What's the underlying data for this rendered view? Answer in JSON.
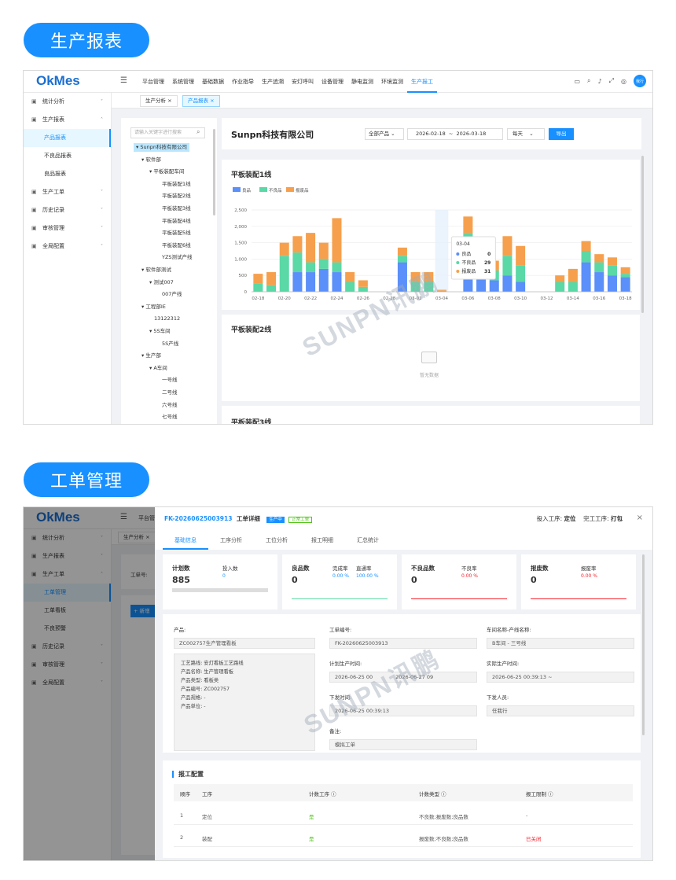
{
  "section1": {
    "title": "生产报表"
  },
  "section2": {
    "title": "工单管理"
  },
  "app": {
    "logo": "OkMes",
    "user": "我行"
  },
  "topnav": [
    "平台管理",
    "系统管理",
    "基础数据",
    "作业指导",
    "生产追溯",
    "安灯呼叫",
    "设备管理",
    "静电监测",
    "环境监测",
    "生产报工"
  ],
  "sidebar1": [
    {
      "label": "统计分析",
      "icon": "chart-icon",
      "chev": "⌄"
    },
    {
      "label": "生产报表",
      "icon": "doc-icon",
      "chev": "⌃"
    },
    {
      "label": "产品报表",
      "sub": true,
      "selected": true
    },
    {
      "label": "不良品报表",
      "sub": true
    },
    {
      "label": "良品报表",
      "sub": true
    },
    {
      "label": "生产工单",
      "icon": "order-icon",
      "chev": "⌄"
    },
    {
      "label": "历史记录",
      "icon": "history-icon",
      "chev": "⌄"
    },
    {
      "label": "审核管理",
      "icon": "audit-icon",
      "chev": "⌄"
    },
    {
      "label": "全局配置",
      "icon": "gear-icon",
      "chev": "⌄"
    }
  ],
  "tabs1": [
    {
      "label": "生产分析 ×"
    },
    {
      "label": "产品报表 ×",
      "active": true
    }
  ],
  "tree": {
    "search_placeholder": "请输入关键字进行搜索",
    "nodes": [
      {
        "t": "Sunpn科技有限公司",
        "d": 0,
        "sel": true
      },
      {
        "t": "软件部",
        "d": 1
      },
      {
        "t": "平板装配车间",
        "d": 2
      },
      {
        "t": "平板装配1线",
        "d": 3
      },
      {
        "t": "平板装配2线",
        "d": 3
      },
      {
        "t": "平板装配3线",
        "d": 3
      },
      {
        "t": "平板装配4线",
        "d": 3
      },
      {
        "t": "平板装配5线",
        "d": 3
      },
      {
        "t": "平板装配6线",
        "d": 3
      },
      {
        "t": "YZS测试产线",
        "d": 3
      },
      {
        "t": "软件部测试",
        "d": 1
      },
      {
        "t": "测试007",
        "d": 2
      },
      {
        "t": "007产线",
        "d": 3
      },
      {
        "t": "工程部IE",
        "d": 1
      },
      {
        "t": "13122312",
        "d": 2
      },
      {
        "t": "5S车间",
        "d": 2
      },
      {
        "t": "5S产线",
        "d": 3
      },
      {
        "t": "生产部",
        "d": 1
      },
      {
        "t": "A车间",
        "d": 2
      },
      {
        "t": "一号线",
        "d": 3
      },
      {
        "t": "二号线",
        "d": 3
      },
      {
        "t": "六号线",
        "d": 3
      },
      {
        "t": "七号线",
        "d": 3
      }
    ]
  },
  "report": {
    "company": "Sunpn科技有限公司",
    "product_select": "全部产品",
    "date_from": "2026-02-18",
    "date_sep": "~",
    "date_to": "2026-03-18",
    "period": "每天",
    "export": "导出",
    "line2": "平板装配2线",
    "line3": "平板装配3线",
    "empty": "暂无数据"
  },
  "chart_data": {
    "type": "bar",
    "title": "平板装配1线",
    "stacked": true,
    "legend": [
      "良品",
      "不良品",
      "报废品"
    ],
    "colors": [
      "#5b8ff9",
      "#5ad8a6",
      "#f6a04d"
    ],
    "ylim": [
      0,
      2500
    ],
    "yticks": [
      "0",
      "500",
      "1,000",
      "1,500",
      "2,000",
      "2,500"
    ],
    "categories": [
      "02-18",
      "02-19",
      "02-20",
      "02-21",
      "02-22",
      "02-23",
      "02-24",
      "02-25",
      "02-26",
      "02-27",
      "02-28",
      "03-01",
      "03-02",
      "03-03",
      "03-04",
      "03-05",
      "03-06",
      "03-07",
      "03-08",
      "03-09",
      "03-10",
      "03-11",
      "03-12",
      "03-13",
      "03-14",
      "03-15",
      "03-16",
      "03-17",
      "03-18"
    ],
    "xticklabels": [
      "02-18",
      "02-20",
      "02-22",
      "02-24",
      "02-26",
      "02-28",
      "03-02",
      "03-04",
      "03-06",
      "03-08",
      "03-10",
      "03-12",
      "03-14",
      "03-16",
      "03-18"
    ],
    "series": [
      {
        "name": "良品",
        "values": [
          0,
          0,
          0,
          600,
          600,
          700,
          600,
          0,
          0,
          0,
          0,
          900,
          0,
          0,
          0,
          0,
          1200,
          400,
          350,
          500,
          300,
          0,
          0,
          0,
          0,
          900,
          600,
          500,
          450
        ]
      },
      {
        "name": "不良品",
        "values": [
          250,
          200,
          1100,
          600,
          300,
          300,
          300,
          300,
          150,
          0,
          0,
          200,
          300,
          300,
          29,
          0,
          600,
          400,
          300,
          600,
          500,
          0,
          0,
          300,
          300,
          350,
          300,
          300,
          100
        ]
      },
      {
        "name": "报废品",
        "values": [
          300,
          400,
          400,
          500,
          900,
          500,
          1350,
          300,
          200,
          0,
          0,
          250,
          300,
          300,
          31,
          0,
          500,
          350,
          300,
          600,
          600,
          0,
          0,
          200,
          400,
          300,
          250,
          250,
          200
        ]
      }
    ],
    "tooltip": {
      "date": "03-04",
      "rows": [
        {
          "name": "良品",
          "value": "0"
        },
        {
          "name": "不良品",
          "value": "29"
        },
        {
          "name": "报废品",
          "value": "31"
        }
      ]
    }
  },
  "sidebar2": [
    {
      "label": "统计分析",
      "chev": "⌄"
    },
    {
      "label": "生产报表",
      "chev": "⌄"
    },
    {
      "label": "生产工单",
      "chev": "⌃"
    },
    {
      "label": "工单管理",
      "sub": true,
      "selected": true
    },
    {
      "label": "工单看板",
      "sub": true
    },
    {
      "label": "不良预警",
      "sub": true
    },
    {
      "label": "历史记录",
      "chev": "⌄"
    },
    {
      "label": "审核管理",
      "chev": "⌄"
    },
    {
      "label": "全局配置",
      "chev": "⌄"
    }
  ],
  "bg": {
    "tab": "生产分析",
    "filter": "工单号:",
    "add": "+ 新增"
  },
  "drawer": {
    "order_no": "FK-20260625003913",
    "title": "工单详细",
    "badge1": "生产中",
    "badge2": "正常工单",
    "in_proc_label": "投入工序:",
    "in_proc": "定位",
    "out_proc_label": "完工工序:",
    "out_proc": "打包",
    "tabs": [
      "基础信息",
      "工序分析",
      "工位分析",
      "报工明细",
      "汇总统计"
    ],
    "stats": [
      {
        "k": "计划数",
        "v": "885",
        "k2": "投入数",
        "v2": "0"
      },
      {
        "k": "良品数",
        "v": "0",
        "k2": "完成率",
        "v2": "0.00 %",
        "k3": "直通率",
        "v3": "100.00 %"
      },
      {
        "k": "不良品数",
        "v": "0",
        "k2": "不良率",
        "v2": "0.00 %"
      },
      {
        "k": "报废数",
        "v": "0",
        "k2": "报废率",
        "v2": "0.00 %"
      }
    ],
    "product_label": "产品:",
    "product": "ZC002757生产管理看板",
    "detail": [
      "工艺路线:  安灯看板工艺路线",
      "产品名称:  生产管理看板",
      "产品类型:  看板类",
      "产品编号:  ZC002757",
      "产品规格:  -",
      "产品单位:  -"
    ],
    "orderno_label": "工单编号:",
    "orderno": "FK-20260625003913",
    "plan_label": "计划生产时间:",
    "plan_from": "2026-06-25 00",
    "plan_to": "2026-06-27 09",
    "issue_label": "下发时间:",
    "issue": "2026-06-25 00:39:13",
    "remark_label": "备注:",
    "remark": "模拟工单",
    "line_label": "车间名称-产线名称:",
    "line": "B车间 - 三号线",
    "actual_label": "实际生产时间:",
    "actual": "2026-06-25 00:39:13 ~",
    "issuer_label": "下发人员:",
    "issuer": "任我行",
    "cfg_title": "报工配置",
    "cols": [
      "顺序",
      "工序",
      "计数工序 ⓘ",
      "计数类型 ⓘ",
      "报工限制 ⓘ"
    ],
    "rows": [
      {
        "seq": "1",
        "proc": "定位",
        "count": "是",
        "type": "不良数;报废数;良品数",
        "limit": "-"
      },
      {
        "seq": "2",
        "proc": "装配",
        "count": "是",
        "type": "报废数;不良数;良品数",
        "limit": "已关闭"
      }
    ]
  },
  "watermark": "SUNPN讯鹏"
}
